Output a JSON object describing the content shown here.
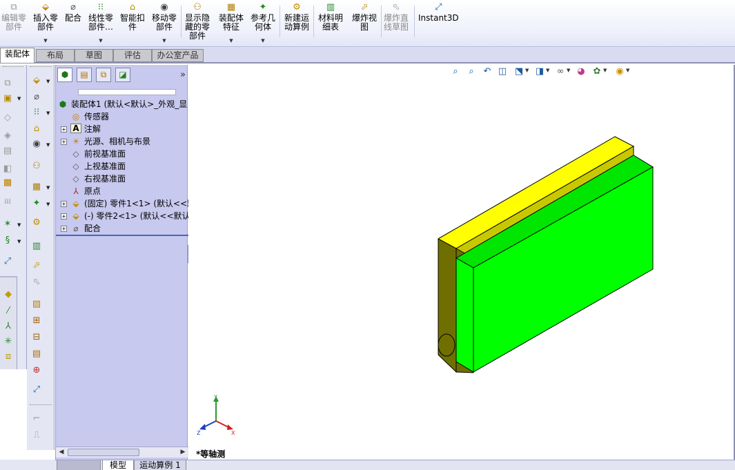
{
  "toolbar": {
    "buttons": [
      {
        "label": "编辑零\n部件",
        "icon": "edit-component-icon",
        "disabled": true
      },
      {
        "label": "插入零\n部件",
        "icon": "insert-component-icon",
        "disabled": false
      },
      {
        "label": "配合",
        "icon": "mate-icon",
        "disabled": false
      },
      {
        "label": "线性零\n部件…",
        "icon": "linear-pattern-icon",
        "disabled": false
      },
      {
        "label": "智能扣\n件",
        "icon": "smart-fasteners-icon",
        "disabled": false
      },
      {
        "label": "移动零\n部件",
        "icon": "move-component-icon",
        "disabled": false
      },
      {
        "label": "显示隐\n藏的零\n部件",
        "icon": "show-hidden-components-icon",
        "disabled": false
      },
      {
        "label": "装配体\n特征",
        "icon": "assembly-features-icon",
        "disabled": false
      },
      {
        "label": "参考几\n何体",
        "icon": "reference-geometry-icon",
        "disabled": false
      },
      {
        "label": "新建运\n动算例",
        "icon": "new-motion-study-icon",
        "disabled": false
      },
      {
        "label": "材料明\n细表",
        "icon": "bill-of-materials-icon",
        "disabled": false
      },
      {
        "label": "爆炸视\n图",
        "icon": "exploded-view-icon",
        "disabled": false
      },
      {
        "label": "爆炸直\n线草图",
        "icon": "explode-line-sketch-icon",
        "disabled": true
      },
      {
        "label": "Instant3D",
        "icon": "instant3d-icon",
        "disabled": false
      }
    ]
  },
  "tabs": [
    "装配体",
    "布局",
    "草图",
    "评估",
    "办公室产品"
  ],
  "active_tab": "装配体",
  "feature_manager": {
    "tree": [
      {
        "label": "装配体1  (默认<默认>_外观_显",
        "icon": "assembly-icon",
        "expander": "",
        "level": 0
      },
      {
        "label": "传感器",
        "icon": "sensor-icon",
        "expander": "",
        "level": 1
      },
      {
        "label": "注解",
        "icon": "annotations-icon",
        "expander": "+",
        "level": 1
      },
      {
        "label": "光源、相机与布景",
        "icon": "lights-cameras-icon",
        "expander": "+",
        "level": 1
      },
      {
        "label": "前视基准面",
        "icon": "plane-icon",
        "expander": "",
        "level": 1
      },
      {
        "label": "上视基准面",
        "icon": "plane-icon",
        "expander": "",
        "level": 1
      },
      {
        "label": "右视基准面",
        "icon": "plane-icon",
        "expander": "",
        "level": 1
      },
      {
        "label": "原点",
        "icon": "origin-icon",
        "expander": "",
        "level": 1
      },
      {
        "label": "(固定) 零件1<1> (默认<<默",
        "icon": "part-icon",
        "expander": "+",
        "level": 1
      },
      {
        "label": "(-) 零件2<1> (默认<<默认>",
        "icon": "part-icon",
        "expander": "+",
        "level": 1
      },
      {
        "label": "配合",
        "icon": "mates-folder-icon",
        "expander": "+",
        "level": 1
      }
    ]
  },
  "viewport": {
    "view_name": "*等轴测",
    "triad_labels": {
      "x": "X",
      "y": "Y",
      "z": "Z"
    },
    "colors": {
      "top_face": "#ffff00",
      "yellow_side": "#6f6f00",
      "yellow_slot": "#c8c800",
      "green_front": "#00ff00",
      "green_top": "#00e600",
      "edge": "#000000"
    }
  },
  "bottom_tabs": [
    "模型",
    "运动算例 1"
  ],
  "active_bottom_tab": "模型"
}
